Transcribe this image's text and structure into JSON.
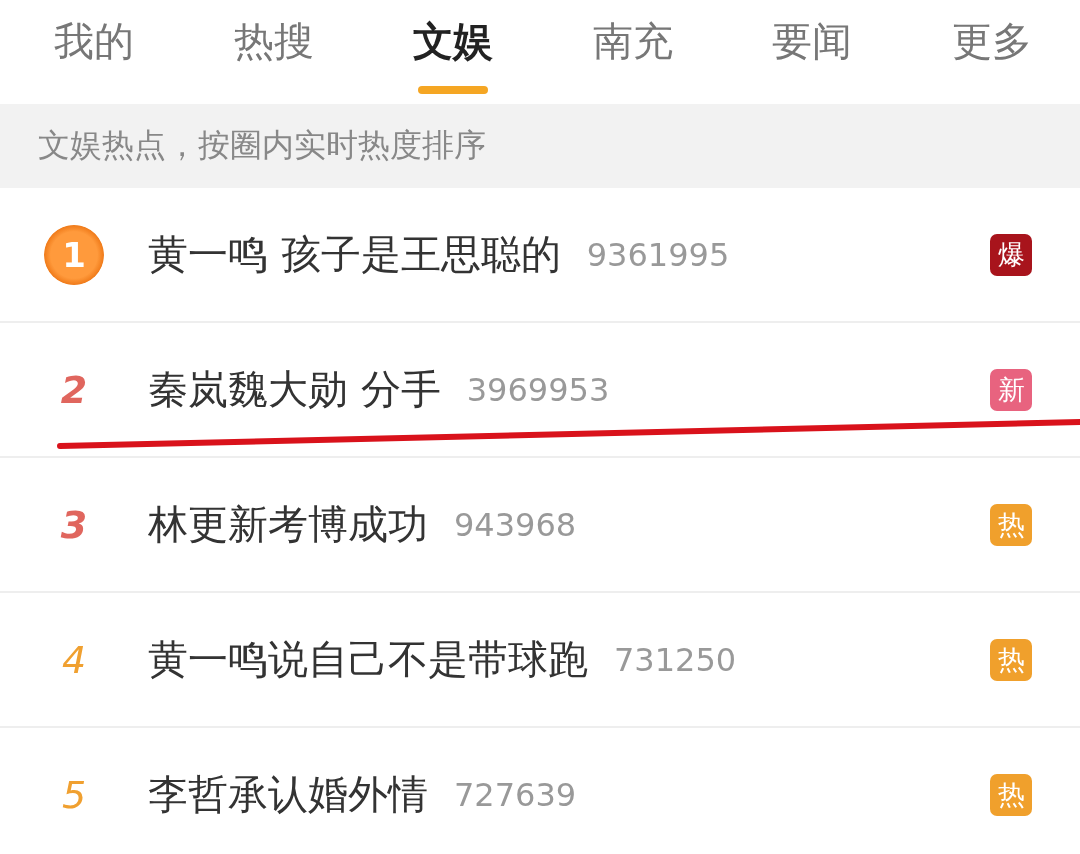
{
  "tabs": [
    {
      "label": "我的",
      "selected": false
    },
    {
      "label": "热搜",
      "selected": false
    },
    {
      "label": "文娱",
      "selected": true
    },
    {
      "label": "南充",
      "selected": false
    },
    {
      "label": "要闻",
      "selected": false
    },
    {
      "label": "更多",
      "selected": false
    }
  ],
  "subtitle": "文娱热点，按圈内实时热度排序",
  "items": [
    {
      "rank": "1",
      "kind": "medal",
      "title": "黄一鸣 孩子是王思聪的",
      "count": "9361995",
      "badge": "爆",
      "color": "#a8141c",
      "underlined": false
    },
    {
      "rank": "2",
      "kind": "top",
      "title": "秦岚魏大勋 分手",
      "count": "3969953",
      "badge": "新",
      "color": "#e8637f",
      "underlined": true
    },
    {
      "rank": "3",
      "kind": "top",
      "title": "林更新考博成功",
      "count": "943968",
      "badge": "热",
      "color": "#f0a02c",
      "underlined": false
    },
    {
      "rank": "4",
      "kind": "normal",
      "title": "黄一鸣说自己不是带球跑",
      "count": "731250",
      "badge": "热",
      "color": "#f0a02c",
      "underlined": false
    },
    {
      "rank": "5",
      "kind": "normal",
      "title": "李哲承认婚外情",
      "count": "727639",
      "badge": "热",
      "color": "#f0a02c",
      "underlined": false
    }
  ]
}
